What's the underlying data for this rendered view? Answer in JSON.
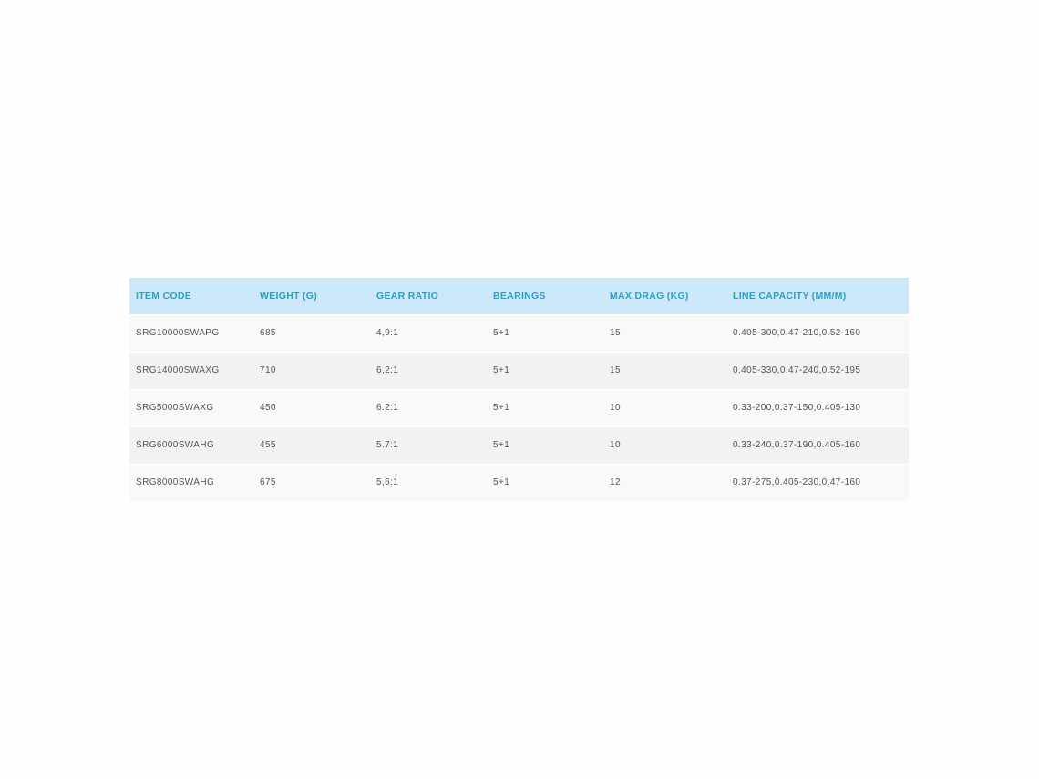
{
  "table": {
    "headers": [
      "ITEM CODE",
      "WEIGHT (G)",
      "GEAR RATIO",
      "BEARINGS",
      "MAX DRAG (KG)",
      "LINE CAPACITY (MM/M)"
    ],
    "rows": [
      [
        "SRG10000SWAPG",
        "685",
        "4,9:1",
        "5+1",
        "15",
        "0.405-300,0.47-210,0.52-160"
      ],
      [
        "SRG14000SWAXG",
        "710",
        "6,2:1",
        "5+1",
        "15",
        "0.405-330,0.47-240,0.52-195"
      ],
      [
        "SRG5000SWAXG",
        "450",
        "6.2:1",
        "5+1",
        "10",
        "0.33-200,0.37-150,0.405-130"
      ],
      [
        "SRG6000SWAHG",
        "455",
        "5.7:1",
        "5+1",
        "10",
        "0.33-240,0.37-190,0.405-160"
      ],
      [
        "SRG8000SWAHG",
        "675",
        "5,6:1",
        "5+1",
        "12",
        "0.37-275,0.405-230,0.47-160"
      ]
    ]
  },
  "colors": {
    "header_bg": "#cde9f9",
    "header_text": "#2b9fc7",
    "row_odd": "#f9f9f9",
    "row_even": "#f2f2f2",
    "cell_text": "#555555"
  }
}
